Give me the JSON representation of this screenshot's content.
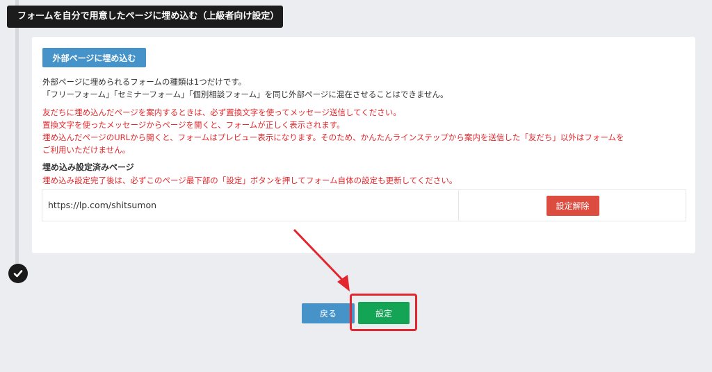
{
  "section": {
    "title": "フォームを自分で用意したページに埋め込む（上級者向け設定）"
  },
  "panel": {
    "embed_button_label": "外部ページに埋め込む",
    "info_lines": [
      "外部ページに埋められるフォームの種類は1つだけです。",
      "「フリーフォーム」「セミナーフォーム」「個別相談フォーム」を同じ外部ページに混在させることはできません。"
    ],
    "warning_lines": [
      "友だちに埋め込んだページを案内するときは、必ず置換文字を使ってメッセージ送信してください。",
      "置換文字を使ったメッセージからページを開くと、フォームが正しく表示されます。",
      "埋め込んだページのURLから開くと、フォームはプレビュー表示になります。そのため、かんたんラインステップから案内を送信した「友だち」以外はフォームを",
      "ご利用いただけません。"
    ],
    "configured_heading": "埋め込み設定済みページ",
    "configured_warning": "埋め込み設定完了後は、必ずこのページ最下部の「設定」ボタンを押してフォーム自体の設定も更新してください。",
    "pages": [
      {
        "url": "https://lp.com/shitsumon",
        "unset_label": "設定解除"
      }
    ]
  },
  "footer": {
    "back_label": "戻る",
    "save_label": "設定"
  },
  "icons": {
    "step_check": "check-icon",
    "annotation": "arrow-icon"
  },
  "colors": {
    "accent_blue": "#4593c9",
    "warning_red": "#e5262a",
    "save_green": "#13a456",
    "highlight_red": "#e3262d"
  }
}
